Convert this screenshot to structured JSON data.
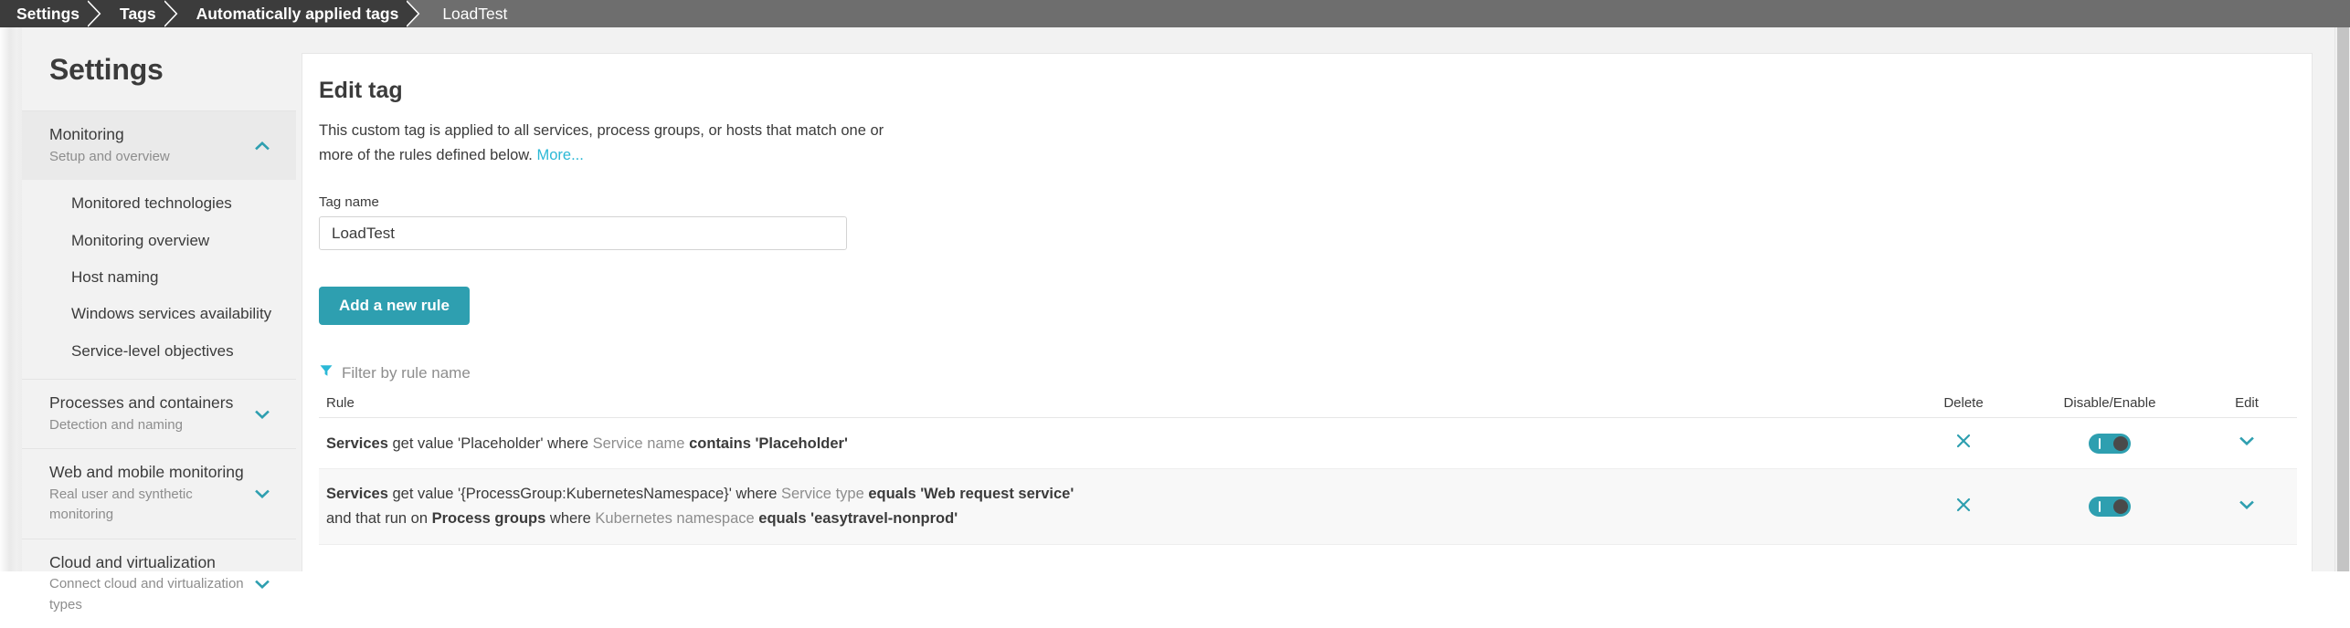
{
  "breadcrumb": {
    "items": [
      {
        "label": "Settings",
        "current": false
      },
      {
        "label": "Tags",
        "current": false
      },
      {
        "label": "Automatically applied tags",
        "current": false
      },
      {
        "label": "LoadTest",
        "current": true
      }
    ]
  },
  "sidebar": {
    "title": "Settings",
    "groups": [
      {
        "title": "Monitoring",
        "subtitle": "Setup and overview",
        "expanded": true,
        "chevron": "chevron-up-icon",
        "items": [
          "Monitored technologies",
          "Monitoring overview",
          "Host naming",
          "Windows services availability",
          "Service-level objectives"
        ]
      },
      {
        "title": "Processes and containers",
        "subtitle": "Detection and naming",
        "expanded": false,
        "chevron": "chevron-down-icon",
        "items": []
      },
      {
        "title": "Web and mobile monitoring",
        "subtitle": "Real user and synthetic monitoring",
        "expanded": false,
        "chevron": "chevron-down-icon",
        "items": []
      },
      {
        "title": "Cloud and virtualization",
        "subtitle": "Connect cloud and virtualization types",
        "expanded": false,
        "chevron": "chevron-down-icon",
        "items": []
      }
    ]
  },
  "main": {
    "page_title": "Edit tag",
    "intro_text": "This custom tag is applied to all services, process groups, or hosts that match one or more of the rules defined below. ",
    "intro_link": "More...",
    "tag_name_label": "Tag name",
    "tag_name_value": "LoadTest",
    "tag_name_placeholder": "Tag name",
    "add_rule_label": "Add a new rule",
    "filter_label": "Filter by rule name",
    "filter_icon": "funnel-icon",
    "table": {
      "headers": {
        "rule": "Rule",
        "delete": "Delete",
        "toggle": "Disable/Enable",
        "edit": "Edit"
      },
      "rows": [
        {
          "lines": [
            [
              {
                "t": "Services",
                "s": "bold"
              },
              {
                "t": " get value 'Placeholder' where ",
                "s": "normal"
              },
              {
                "t": "Service name",
                "s": "dim"
              },
              {
                "t": " contains 'Placeholder'",
                "s": "bold"
              }
            ]
          ],
          "delete_icon": "close-x-icon",
          "enabled": true,
          "edit_icon": "chevron-down-icon"
        },
        {
          "lines": [
            [
              {
                "t": "Services",
                "s": "bold"
              },
              {
                "t": " get value '{ProcessGroup:KubernetesNamespace}' where ",
                "s": "normal"
              },
              {
                "t": "Service type",
                "s": "dim"
              },
              {
                "t": " equals 'Web request service'",
                "s": "bold"
              }
            ],
            [
              {
                "t": "and that run on ",
                "s": "normal"
              },
              {
                "t": "Process groups",
                "s": "bold"
              },
              {
                "t": " where ",
                "s": "normal"
              },
              {
                "t": "Kubernetes namespace",
                "s": "dim"
              },
              {
                "t": " equals 'easytravel-nonprod'",
                "s": "bold"
              }
            ]
          ],
          "delete_icon": "close-x-icon",
          "enabled": true,
          "edit_icon": "chevron-down-icon"
        }
      ]
    }
  },
  "colors": {
    "accent": "#2e9fb0",
    "link": "#2bb8d6",
    "breadcrumb_bg": "#3c3c3c",
    "breadcrumb_current_bg": "#6e6e6e",
    "text": "#3b3b3b",
    "muted": "#8d8d8d"
  }
}
